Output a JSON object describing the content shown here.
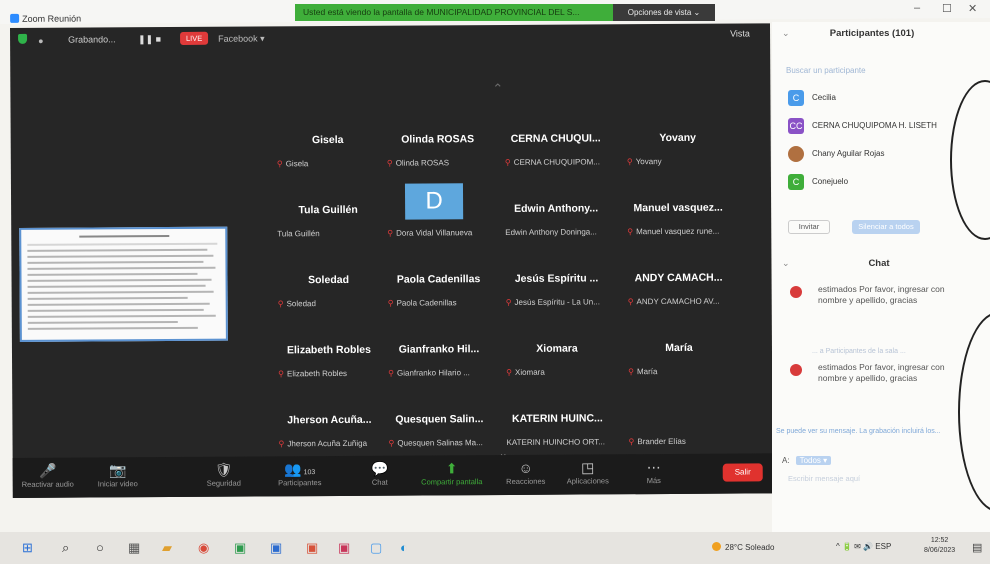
{
  "window": {
    "title": "Zoom Reunión",
    "share_banner": "Usted está viendo la pantalla de MUNICIPALIDAD PROVINCIAL DEL S...",
    "view_options": "Opciones de vista ⌄",
    "controls": [
      "–",
      "☐",
      "✕"
    ]
  },
  "meeting_topbar": {
    "recording": "Grabando...",
    "pause_stop": "❚❚  ■",
    "live_badge": "LIVE",
    "live_on": "Facebook ▾",
    "view": "Vista"
  },
  "participants_grid": [
    {
      "name": "Gisela",
      "sub": "Gisela"
    },
    {
      "name": "Olinda ROSAS",
      "sub": "Olinda ROSAS"
    },
    {
      "name": "CERNA CHUQUI...",
      "sub": "CERNA CHUQUIPOM..."
    },
    {
      "name": "Yovany",
      "sub": "Yovany"
    },
    {
      "name": "Tula Guillén",
      "sub": "Tula Guillén"
    },
    {
      "name": "D",
      "sub": "Dora Vidal Villanueva",
      "avatar": true
    },
    {
      "name": "Edwin Anthony...",
      "sub": "Edwin Anthony Doninga..."
    },
    {
      "name": "Manuel vasquez...",
      "sub": "Manuel vasquez rune..."
    },
    {
      "name": "Soledad",
      "sub": "Soledad"
    },
    {
      "name": "Paola Cadenillas",
      "sub": "Paola Cadenillas"
    },
    {
      "name": "Jesús Espíritu ...",
      "sub": "Jesús Espíritu - La Un..."
    },
    {
      "name": "ANDY CAMACH...",
      "sub": "ANDY CAMACHO AV..."
    },
    {
      "name": "Elizabeth Robles",
      "sub": "Elizabeth Robles"
    },
    {
      "name": "Gianfranko Hil...",
      "sub": "Gianfranko Hilario ..."
    },
    {
      "name": "Xiomara",
      "sub": "Xiomara"
    },
    {
      "name": "María",
      "sub": "María"
    },
    {
      "name": "Jherson Acuña...",
      "sub": "Jherson Acuña Zuñiga"
    },
    {
      "name": "Quesquen Salin...",
      "sub": "Quesquen Salinas Ma..."
    },
    {
      "name": "KATERIN HUINC...",
      "sub": "KATERIN HUINCHO ORT..."
    },
    {
      "name": "",
      "sub": "Brander Elías"
    }
  ],
  "toolbar": {
    "buttons": [
      {
        "icon": "🎤",
        "label": "Reactivar audio"
      },
      {
        "icon": "📷",
        "label": "Iniciar video"
      },
      {
        "icon": "🛡",
        "label": "Seguridad"
      },
      {
        "icon": "👥",
        "label": "Participantes",
        "count": "103"
      },
      {
        "icon": "💬",
        "label": "Chat"
      },
      {
        "icon": "⬆",
        "label": "Compartir pantalla"
      },
      {
        "icon": "☺",
        "label": "Reacciones"
      },
      {
        "icon": "◳",
        "label": "Aplicaciones"
      },
      {
        "icon": "⋯",
        "label": "Más"
      }
    ],
    "leave": "Salir"
  },
  "panel": {
    "participants_header": "Participantes (101)",
    "search_placeholder": "Buscar un participante",
    "participants": [
      {
        "initials": "C",
        "name": "Cecilia",
        "color": "#4a9bea"
      },
      {
        "initials": "CC",
        "name": "CERNA CHUQUIPOMA H. LISETH",
        "color": "#8a52c6"
      },
      {
        "initials": "",
        "name": "Chany Aguilar Rojas",
        "color": "#b07040"
      },
      {
        "initials": "C",
        "name": "Conejuelo",
        "color": "#3fae3a"
      }
    ],
    "invite": "Invitar",
    "mute_all": "Silenciar a todos",
    "chat_header": "Chat",
    "messages": [
      {
        "text": "estimados Por favor, ingresar con nombre y apellido, gracias"
      },
      {
        "text": "estimados Por favor, ingresar con nombre y apellido, gracias"
      }
    ],
    "system_line": "... a Participantes de la sala ...",
    "notice": "Se puede ver su mensaje. La grabación incluirá los...",
    "to_label": "A:",
    "to_value": "Todos ▾",
    "compose_placeholder": "Escribir mensaje aquí"
  },
  "taskbar": {
    "weather": "28°C  Soleado",
    "tray": "^  🔋  ✉  🔊  ESP",
    "time": "12:52",
    "date": "8/06/2023"
  },
  "colors": {
    "meeting_bg": "#262626",
    "share_banner": "#3fae3a",
    "leave": "#e0322e",
    "accent": "#2d8cff"
  }
}
